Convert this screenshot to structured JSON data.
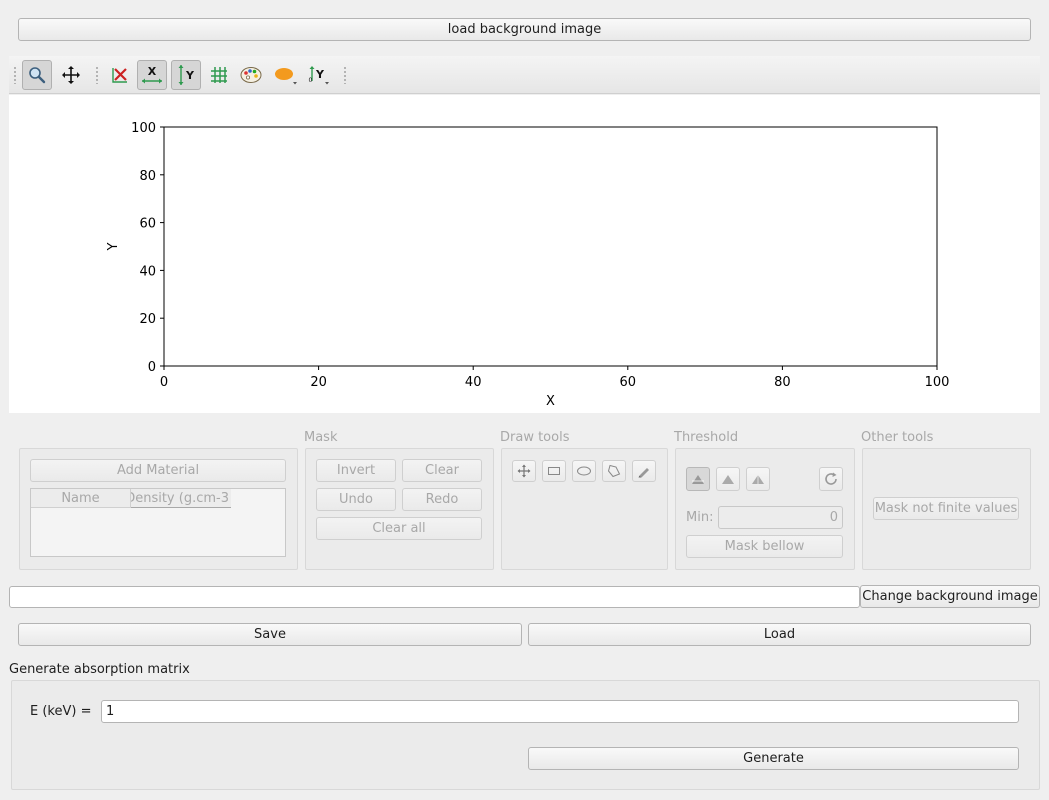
{
  "top": {
    "load_bg_label": "load background image"
  },
  "toolbar": {
    "items": [
      {
        "name": "zoom-icon",
        "active": true
      },
      {
        "name": "pan-icon",
        "active": false
      },
      {
        "name": "clear-axis-icon",
        "active": false
      },
      {
        "name": "x-axis-icon",
        "active": true
      },
      {
        "name": "y-axis-icon",
        "active": true
      },
      {
        "name": "grid-icon",
        "active": false
      },
      {
        "name": "palette-icon",
        "active": false
      },
      {
        "name": "marker-color-icon",
        "active": false
      },
      {
        "name": "y-scale-icon",
        "active": false
      }
    ]
  },
  "chart_data": {
    "type": "line",
    "series": [],
    "xlabel": "X",
    "ylabel": "Y",
    "xlim": [
      0,
      100
    ],
    "ylim": [
      0,
      100
    ],
    "xticks": [
      0,
      20,
      40,
      60,
      80,
      100
    ],
    "yticks": [
      0,
      20,
      40,
      60,
      80,
      100
    ],
    "grid": false
  },
  "materials": {
    "add_label": "Add Material",
    "columns": [
      "Name",
      "Density (g.cm-3"
    ]
  },
  "mask": {
    "title": "Mask",
    "invert": "Invert",
    "clear": "Clear",
    "undo": "Undo",
    "redo": "Redo",
    "clear_all": "Clear all"
  },
  "draw_tools": {
    "title": "Draw tools",
    "icons": [
      "move-icon",
      "rectangle-icon",
      "ellipse-icon",
      "polygon-icon",
      "pencil-icon"
    ]
  },
  "threshold": {
    "title": "Threshold",
    "min_label": "Min:",
    "min_value": "0",
    "mask_below": "Mask bellow"
  },
  "other_tools": {
    "title": "Other tools",
    "mask_nonfinite": "Mask not finite values"
  },
  "background": {
    "path_value": "",
    "change_label": "Change background image"
  },
  "actions": {
    "save": "Save",
    "load": "Load"
  },
  "absorption": {
    "title": "Generate absorption matrix",
    "energy_label": "E (keV) =",
    "energy_value": "1",
    "generate": "Generate"
  },
  "colors": {
    "marker_orange": "#f39a1e",
    "axis_green": "#2e9a4e"
  }
}
